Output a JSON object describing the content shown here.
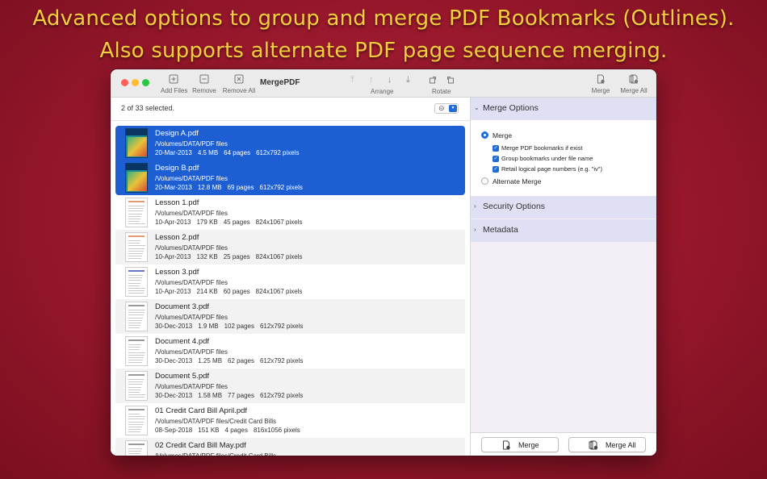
{
  "headline": {
    "line1": "Advanced options to group and merge PDF Bookmarks (Outlines).",
    "line2": "Also supports alternate PDF page sequence merging."
  },
  "window": {
    "title": "MergePDF",
    "toolbar": {
      "add_files": "Add Files",
      "remove": "Remove",
      "remove_all": "Remove All",
      "arrange": "Arrange",
      "rotate": "Rotate",
      "merge": "Merge",
      "merge_all": "Merge All"
    }
  },
  "file_list": {
    "selection_status": "2 of 33 selected.",
    "files": [
      {
        "name": "Design A.pdf",
        "path": "/Volumes/DATA/PDF files",
        "date": "20-Mar-2013",
        "size": "4.5 MB",
        "pages": "64 pages",
        "dims": "612x792 pixels",
        "selected": true
      },
      {
        "name": "Design B.pdf",
        "path": "/Volumes/DATA/PDF files",
        "date": "20-Mar-2013",
        "size": "12.8 MB",
        "pages": "69 pages",
        "dims": "612x792 pixels",
        "selected": true
      },
      {
        "name": "Lesson 1.pdf",
        "path": "/Volumes/DATA/PDF files",
        "date": "10-Apr-2013",
        "size": "179 KB",
        "pages": "45 pages",
        "dims": "824x1067 pixels",
        "selected": false
      },
      {
        "name": "Lesson 2.pdf",
        "path": "/Volumes/DATA/PDF files",
        "date": "10-Apr-2013",
        "size": "132 KB",
        "pages": "25 pages",
        "dims": "824x1067 pixels",
        "selected": false
      },
      {
        "name": "Lesson 3.pdf",
        "path": "/Volumes/DATA/PDF files",
        "date": "10-Apr-2013",
        "size": "214 KB",
        "pages": "60 pages",
        "dims": "824x1067 pixels",
        "selected": false
      },
      {
        "name": "Document 3.pdf",
        "path": "/Volumes/DATA/PDF files",
        "date": "30-Dec-2013",
        "size": "1.9 MB",
        "pages": "102 pages",
        "dims": "612x792 pixels",
        "selected": false
      },
      {
        "name": "Document 4.pdf",
        "path": "/Volumes/DATA/PDF files",
        "date": "30-Dec-2013",
        "size": "1.25 MB",
        "pages": "62 pages",
        "dims": "612x792 pixels",
        "selected": false
      },
      {
        "name": "Document 5.pdf",
        "path": "/Volumes/DATA/PDF files",
        "date": "30-Dec-2013",
        "size": "1.58 MB",
        "pages": "77 pages",
        "dims": "612x792 pixels",
        "selected": false
      },
      {
        "name": "01 Credit Card Bill April.pdf",
        "path": "/Volumes/DATA/PDF files/Credit Card Bills",
        "date": "08-Sep-2018",
        "size": "151 KB",
        "pages": "4 pages",
        "dims": "816x1056 pixels",
        "selected": false
      },
      {
        "name": "02 Credit Card Bill May.pdf",
        "path": "/Volumes/DATA/PDF files/Credit Card Bills",
        "date": "",
        "size": "",
        "pages": "",
        "dims": "",
        "selected": false
      }
    ]
  },
  "options": {
    "merge_options": {
      "header": "Merge Options",
      "merge_label": "Merge",
      "merge_selected": true,
      "bookmarks_label": "Merge PDF bookmarks if exist",
      "group_label": "Group bookmarks under file name",
      "retain_label": "Retail logical page numbers (e.g. \"iv\")",
      "alternate_label": "Alternate Merge",
      "alternate_selected": false
    },
    "security_header": "Security Options",
    "metadata_header": "Metadata",
    "merge_button": "Merge",
    "merge_all_button": "Merge All"
  },
  "colors": {
    "accent": "#1f6bd8",
    "headline": "#f3cf3e",
    "background": "#97172b",
    "selection": "#1d5fd3"
  }
}
